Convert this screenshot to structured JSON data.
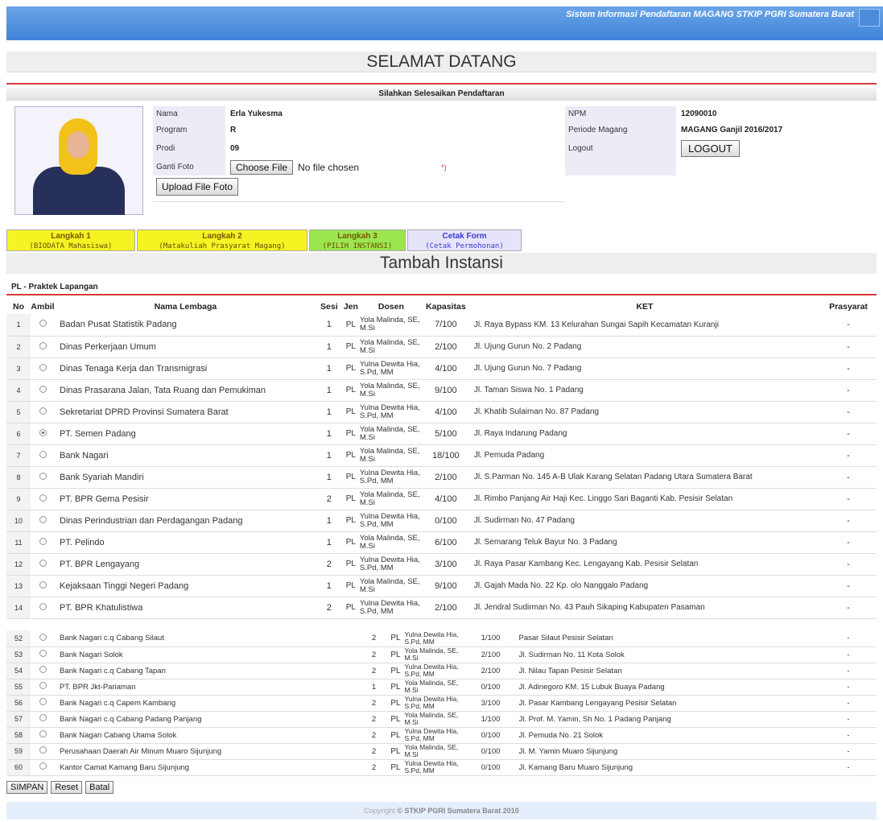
{
  "header": {
    "title": "Sistem Informasi Pendaftaran MAGANG STKIP PGRI Sumatera Barat"
  },
  "welcome": "SELAMAT DATANG",
  "subtitle": "Silahkan Selesaikan Pendaftaran",
  "profile": {
    "nama_label": "Nama",
    "nama": "Erla Yukesma",
    "program_label": "Program",
    "program": "R",
    "prodi_label": "Prodi",
    "prodi": "09",
    "foto_label": "Ganti Foto",
    "choose_file": "Choose File",
    "no_file": "No file chosen",
    "required": "*)",
    "upload": "Upload File Foto",
    "npm_label": "NPM",
    "npm": "12090010",
    "periode_label": "Periode Magang",
    "periode": "MAGANG Ganjil 2016/2017",
    "logout_label": "Logout",
    "logout": "LOGOUT"
  },
  "steps": [
    {
      "title": "Langkah 1",
      "sub": "(BIODATA Mahasiswa)",
      "color": "#f6f323"
    },
    {
      "title": "Langkah 2",
      "sub": "(Matakuliah Prasyarat Magang)",
      "color": "#f6f323"
    },
    {
      "title": "Langkah 3",
      "sub": "(PILIH INSTANSI)",
      "color": "#9be64f"
    },
    {
      "title": "Cetak Form",
      "sub": "(Cetak Permohonan)",
      "color": "#e6e4fb"
    }
  ],
  "section_title": "Tambah Instansi",
  "pl_label": "PL - Praktek Lapangan",
  "columns": {
    "no": "No",
    "ambil": "Ambil",
    "nama": "Nama Lembaga",
    "sesi": "Sesi",
    "jen": "Jen",
    "dosen": "Dosen",
    "kapasitas": "Kapasitas",
    "ket": "KET",
    "prasyarat": "Prasyarat"
  },
  "rows": [
    {
      "no": "1",
      "nama": "Badan Pusat Statistik Padang",
      "sesi": "1",
      "jen": "PL",
      "dosen": "Yola Malinda, SE, M.Si",
      "kap": "7/100",
      "ket": "Jl. Raya Bypass KM. 13 Kelurahan Sungai Sapih Kecamatan Kuranji",
      "pra": "-",
      "sel": false
    },
    {
      "no": "2",
      "nama": "Dinas Perkerjaan Umum",
      "sesi": "1",
      "jen": "PL",
      "dosen": "Yola Malinda, SE, M.Si",
      "kap": "2/100",
      "ket": "Jl. Ujung Gurun No. 2 Padang",
      "pra": "-",
      "sel": false
    },
    {
      "no": "3",
      "nama": "Dinas Tenaga Kerja dan Transmigrasi",
      "sesi": "1",
      "jen": "PL",
      "dosen": "Yulna Dewita Hia, S.Pd, MM",
      "kap": "4/100",
      "ket": "Jl. Ujung Gurun No. 7 Padang",
      "pra": "-",
      "sel": false
    },
    {
      "no": "4",
      "nama": "Dinas Prasarana Jalan, Tata Ruang dan Pemukiman",
      "sesi": "1",
      "jen": "PL",
      "dosen": "Yola Malinda, SE, M.Si",
      "kap": "9/100",
      "ket": "Jl. Taman Siswa No. 1 Padang",
      "pra": "-",
      "sel": false
    },
    {
      "no": "5",
      "nama": "Sekretariat DPRD Provinsi Sumatera Barat",
      "sesi": "1",
      "jen": "PL",
      "dosen": "Yulna Dewita Hia, S.Pd, MM",
      "kap": "4/100",
      "ket": "Jl. Khatib Sulaiman No. 87 Padang",
      "pra": "-",
      "sel": false
    },
    {
      "no": "6",
      "nama": "PT. Semen Padang",
      "sesi": "1",
      "jen": "PL",
      "dosen": "Yola Malinda, SE, M.Si",
      "kap": "5/100",
      "ket": "Jl. Raya Indarung Padang",
      "pra": "-",
      "sel": true
    },
    {
      "no": "7",
      "nama": "Bank Nagari",
      "sesi": "1",
      "jen": "PL",
      "dosen": "Yola Malinda, SE, M.Si",
      "kap": "18/100",
      "ket": "Jl. Pemuda Padang",
      "pra": "-",
      "sel": false
    },
    {
      "no": "8",
      "nama": "Bank Syariah Mandiri",
      "sesi": "1",
      "jen": "PL",
      "dosen": "Yulna Dewita Hia, S.Pd, MM",
      "kap": "2/100",
      "ket": "Jl. S.Parman No. 145 A-B Ulak Karang Selatan Padang Utara Sumatera Barat",
      "pra": "-",
      "sel": false
    },
    {
      "no": "9",
      "nama": "PT. BPR Gema Pesisir",
      "sesi": "2",
      "jen": "PL",
      "dosen": "Yola Malinda, SE, M.Si",
      "kap": "4/100",
      "ket": "Jl. Rimbo Panjang Air Haji Kec. Linggo Sari Baganti Kab. Pesisir Selatan",
      "pra": "-",
      "sel": false
    },
    {
      "no": "10",
      "nama": "Dinas Perindustrian dan Perdagangan Padang",
      "sesi": "1",
      "jen": "PL",
      "dosen": "Yulna Dewita Hia, S.Pd, MM",
      "kap": "0/100",
      "ket": "Jl. Sudirman No. 47 Padang",
      "pra": "-",
      "sel": false
    },
    {
      "no": "11",
      "nama": "PT. Pelindo",
      "sesi": "1",
      "jen": "PL",
      "dosen": "Yola Malinda, SE, M.Si",
      "kap": "6/100",
      "ket": "Jl. Semarang Teluk Bayur No. 3 Padang",
      "pra": "-",
      "sel": false
    },
    {
      "no": "12",
      "nama": "PT. BPR Lengayang",
      "sesi": "2",
      "jen": "PL",
      "dosen": "Yulna Dewita Hia, S.Pd, MM",
      "kap": "3/100",
      "ket": "Jl. Raya Pasar Kambang Kec. Lengayang Kab. Pesisir Selatan",
      "pra": "-",
      "sel": false
    },
    {
      "no": "13",
      "nama": "Kejaksaan Tinggi Negeri Padang",
      "sesi": "1",
      "jen": "PL",
      "dosen": "Yola Malinda, SE, M.Si",
      "kap": "9/100",
      "ket": "Jl. Gajah Mada No. 22 Kp. olo Nanggalo Padang",
      "pra": "-",
      "sel": false
    },
    {
      "no": "14",
      "nama": "PT. BPR Khatulistiwa",
      "sesi": "2",
      "jen": "PL",
      "dosen": "Yulna Dewita Hia, S.Pd, MM",
      "kap": "2/100",
      "ket": "Jl. Jendral Sudirman No. 43 Pauh Sikaping Kabupaten Pasaman",
      "pra": "-",
      "sel": false
    }
  ],
  "rows2": [
    {
      "no": "52",
      "nama": "Bank Nagari c.q Cabang Silaut",
      "sesi": "2",
      "jen": "PL",
      "dosen": "Yulna Dewita Hia, S.Pd, MM",
      "kap": "1/100",
      "ket": "Pasar Silaut Pesisir Selatan",
      "pra": "-"
    },
    {
      "no": "53",
      "nama": "Bank Nagari Solok",
      "sesi": "2",
      "jen": "PL",
      "dosen": "Yola Malinda, SE, M.Si",
      "kap": "2/100",
      "ket": "Jl. Sudirman No. 11 Kota Solok",
      "pra": "-"
    },
    {
      "no": "54",
      "nama": "Bank Nagari c.q Cabang Tapan",
      "sesi": "2",
      "jen": "PL",
      "dosen": "Yulna Dewita Hia, S.Pd, MM",
      "kap": "2/100",
      "ket": "Jl. Nilau Tapan Pesisir Selatan",
      "pra": "-"
    },
    {
      "no": "55",
      "nama": "PT. BPR Jkt-Pariaman",
      "sesi": "1",
      "jen": "PL",
      "dosen": "Yola Malinda, SE, M.Si",
      "kap": "0/100",
      "ket": "Jl. Adinegoro KM. 15 Lubuk Buaya Padang",
      "pra": "-"
    },
    {
      "no": "56",
      "nama": "Bank Nagari c.q Capem Kambang",
      "sesi": "2",
      "jen": "PL",
      "dosen": "Yulna Dewita Hia, S.Pd, MM",
      "kap": "3/100",
      "ket": "Jl. Pasar Kambang Lengayang Pesisir Selatan",
      "pra": "-"
    },
    {
      "no": "57",
      "nama": "Bank Nagari c.q Cabang Padang Panjang",
      "sesi": "2",
      "jen": "PL",
      "dosen": "Yola Malinda, SE, M.Si",
      "kap": "1/100",
      "ket": "Jl. Prof. M. Yamin, Sh No. 1 Padang Panjang",
      "pra": "-"
    },
    {
      "no": "58",
      "nama": "Bank Nagari Cabang Utama Solok",
      "sesi": "2",
      "jen": "PL",
      "dosen": "Yulna Dewita Hia, S.Pd, MM",
      "kap": "0/100",
      "ket": "Jl. Pemuda No. 21 Solok",
      "pra": "-"
    },
    {
      "no": "59",
      "nama": "Perusahaan Daerah Air Minum Muaro Sijunjung",
      "sesi": "2",
      "jen": "PL",
      "dosen": "Yola Malinda, SE, M.Si",
      "kap": "0/100",
      "ket": "Jl. M. Yamin Muaro Sijunjung",
      "pra": "-"
    },
    {
      "no": "60",
      "nama": "Kantor Camat Kamang Baru Sijunjung",
      "sesi": "2",
      "jen": "PL",
      "dosen": "Yulna Dewita Hia, S.Pd, MM",
      "kap": "0/100",
      "ket": "Jl. Kamang Baru Muaro Sijunjung",
      "pra": "-"
    }
  ],
  "actions": {
    "simpan": "SIMPAN",
    "reset": "Reset",
    "batal": "Batal"
  },
  "footer": {
    "prefix": "Copyright",
    "brand": "© STKIP PGRI Sumatera Barat 2010"
  }
}
